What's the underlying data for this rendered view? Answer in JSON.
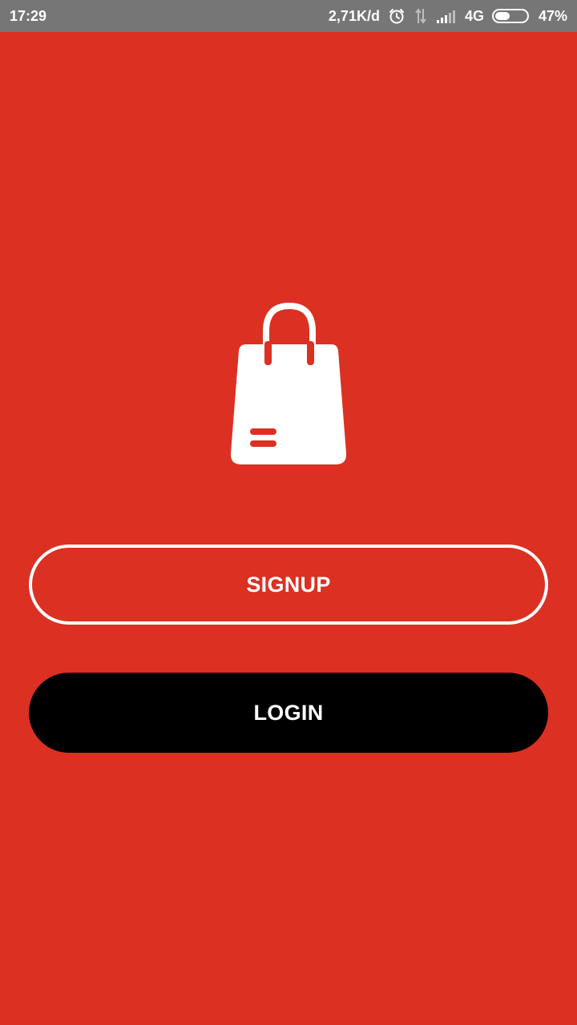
{
  "status_bar": {
    "time": "17:29",
    "network_speed": "2,71K/d",
    "network_type": "4G",
    "battery_percent": "47%",
    "battery_level": 0.47,
    "icons": [
      "alarm-icon",
      "data-transfer-icon",
      "signal-icon",
      "battery-icon"
    ]
  },
  "logo": {
    "icon": "shopping-bag-icon"
  },
  "buttons": {
    "signup_label": "SIGNUP",
    "login_label": "LOGIN"
  },
  "colors": {
    "background": "#dc3022",
    "status_bar": "#767676",
    "login_button": "#000000",
    "signup_outline": "#ffffff",
    "text": "#ffffff"
  }
}
